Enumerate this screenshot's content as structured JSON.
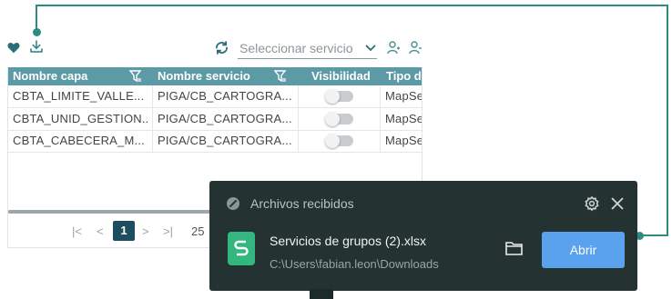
{
  "toolbar": {
    "service_select": {
      "value": "Seleccionar servicio"
    }
  },
  "table": {
    "headers": [
      "Nombre capa",
      "Nombre servicio",
      "Visibilidad",
      "Tipo de"
    ],
    "rows": [
      {
        "layer": "CBTA_LIMITE_VALLE...",
        "service": "PIGA/CB_CARTOGRA...",
        "visible": false,
        "type": "MapSe"
      },
      {
        "layer": "CBTA_UNID_GESTION...",
        "service": "PIGA/CB_CARTOGRA...",
        "visible": false,
        "type": "MapSe"
      },
      {
        "layer": "CBTA_CABECERA_M...",
        "service": "PIGA/CB_CARTOGRA...",
        "visible": false,
        "type": "MapSe"
      }
    ]
  },
  "pagination": {
    "first": "|<",
    "prev": "<",
    "current_page": "1",
    "next": ">",
    "last": ">|",
    "page_size": "25"
  },
  "download_panel": {
    "title": "Archivos recibidos",
    "file_name": "Servicios de grupos (2).xlsx",
    "file_path": "C:\\Users\\fabian.leon\\Downloads",
    "open_label": "Abrir"
  },
  "colors": {
    "accent_teal": "#2e8b84",
    "table_header": "#5c9aa5",
    "page_active": "#1d4e5f",
    "panel_bg": "#243232",
    "open_button": "#5aa1ee",
    "sheet_icon": "#33b77e"
  }
}
